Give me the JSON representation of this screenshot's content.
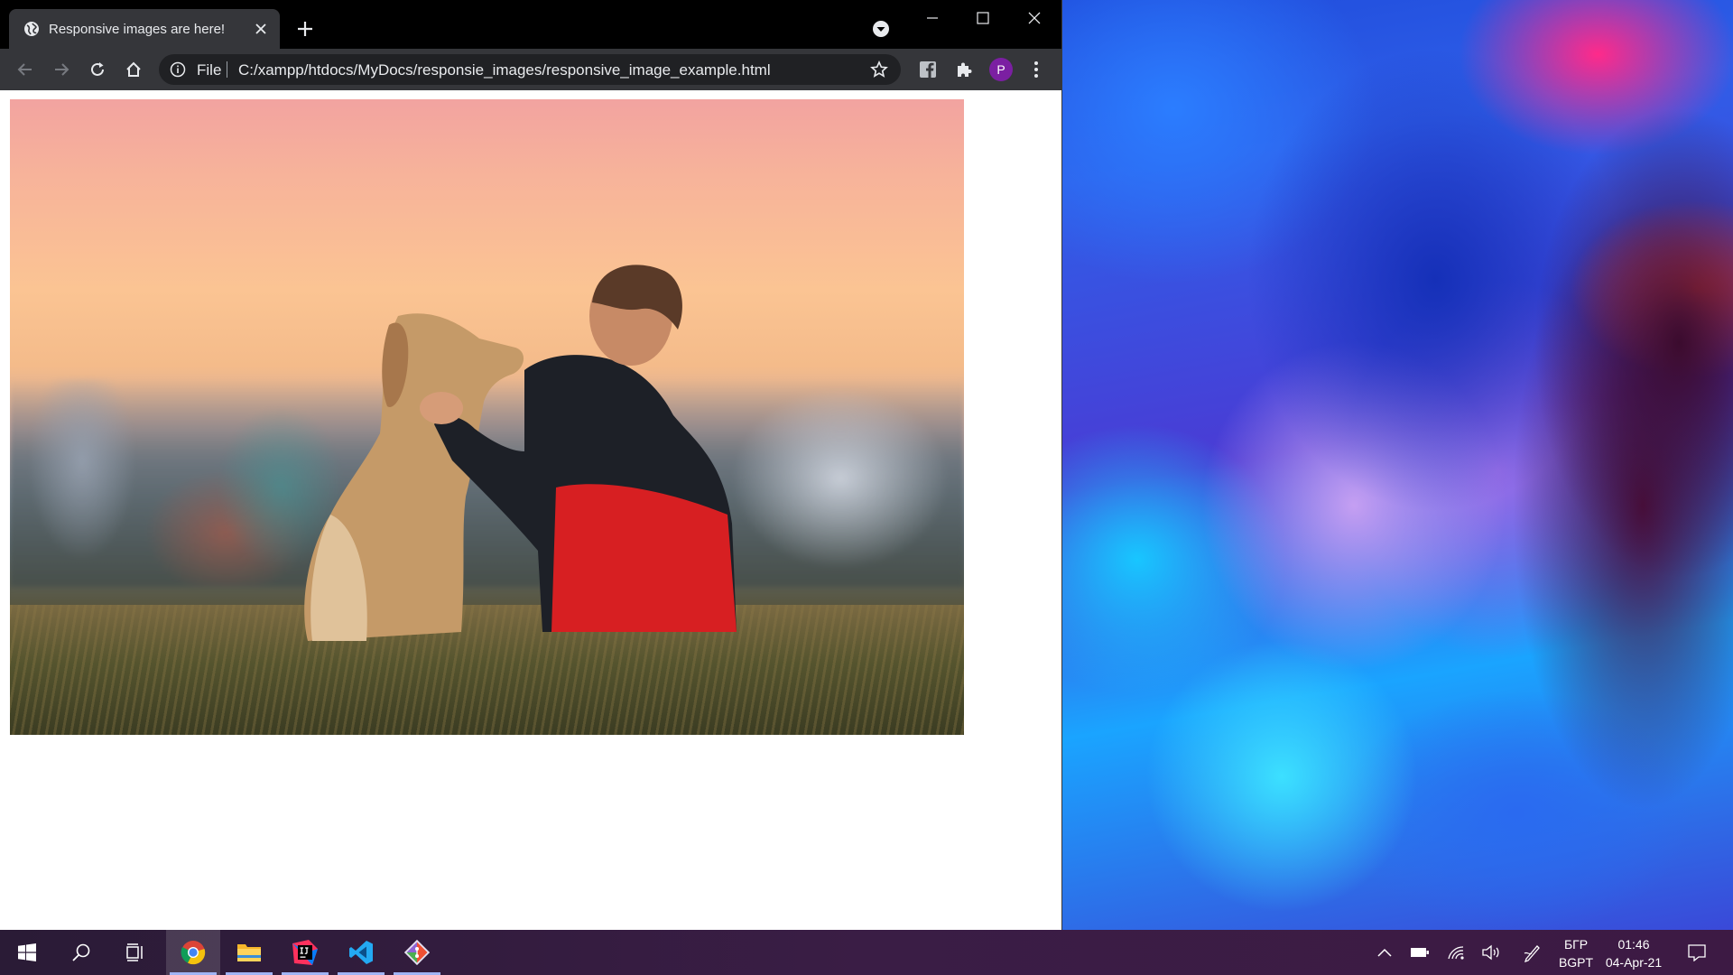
{
  "browser": {
    "tab": {
      "title": "Responsive images are here!"
    },
    "address": {
      "scheme_label": "File",
      "url": "C:/xampp/htdocs/MyDocs/responsie_images/responsive_image_example.html"
    },
    "profile_initial": "P",
    "content": {
      "image_alt": "Man in red and black jacket sitting on grass with his dog at sunset, city skyline blurred behind"
    }
  },
  "taskbar": {
    "apps": [
      {
        "name": "Google Chrome",
        "icon": "chrome-icon",
        "active": true
      },
      {
        "name": "File Explorer",
        "icon": "folder-icon",
        "active": false
      },
      {
        "name": "IntelliJ IDEA",
        "icon": "intellij-icon",
        "active": false
      },
      {
        "name": "Visual Studio Code",
        "icon": "vscode-icon",
        "active": false
      },
      {
        "name": "Git",
        "icon": "git-icon",
        "active": false
      }
    ],
    "tray": {
      "language_line1": "БГР",
      "language_line2": "BGPT",
      "time": "01:46",
      "date": "04-Apr-21"
    }
  },
  "colors": {
    "chrome_dark": "#35363a",
    "omnibox": "#202124",
    "avatar": "#7b1fa2",
    "taskbar": "#3a1d45"
  }
}
